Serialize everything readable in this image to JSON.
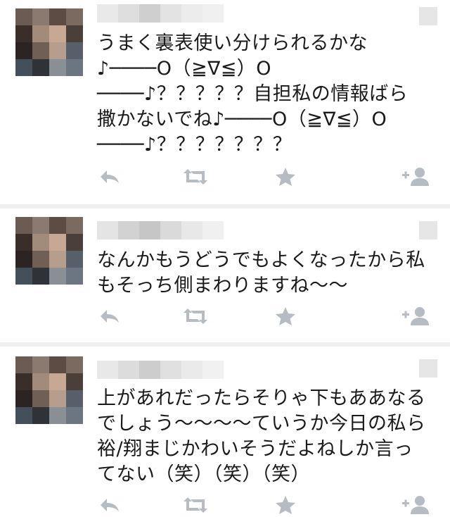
{
  "colors": {
    "icon": "#b5bcc3",
    "text": "#1a1a1a",
    "separator": "#efefef",
    "blur_light": "#e6e6e6"
  },
  "icons": {
    "reply": "reply-arrow-icon",
    "retweet": "retweet-arrows-icon",
    "favorite": "star-icon",
    "follow": "follow-user-plus-icon"
  },
  "tweets": [
    {
      "text_lines": [
        "うまく裏表使い分けられるかな",
        "♪────O（≧∇≦）O",
        "────♪？？？？？自担私の情報ばら",
        "撒かないでね♪────O（≧∇≦）O",
        "────♪？？？？？？？"
      ]
    },
    {
      "text_lines": [
        "なんかもうどうでもよくなったから私",
        "もそっち側まわりますね〜〜"
      ]
    },
    {
      "text_lines": [
        "上があれだったらそりゃ下もああなる",
        "でしょう〜〜〜〜ていうか今日の私ら",
        "裕/翔まじかわいそうだよねしか言っ",
        "てない（笑）（笑）（笑）"
      ]
    }
  ]
}
